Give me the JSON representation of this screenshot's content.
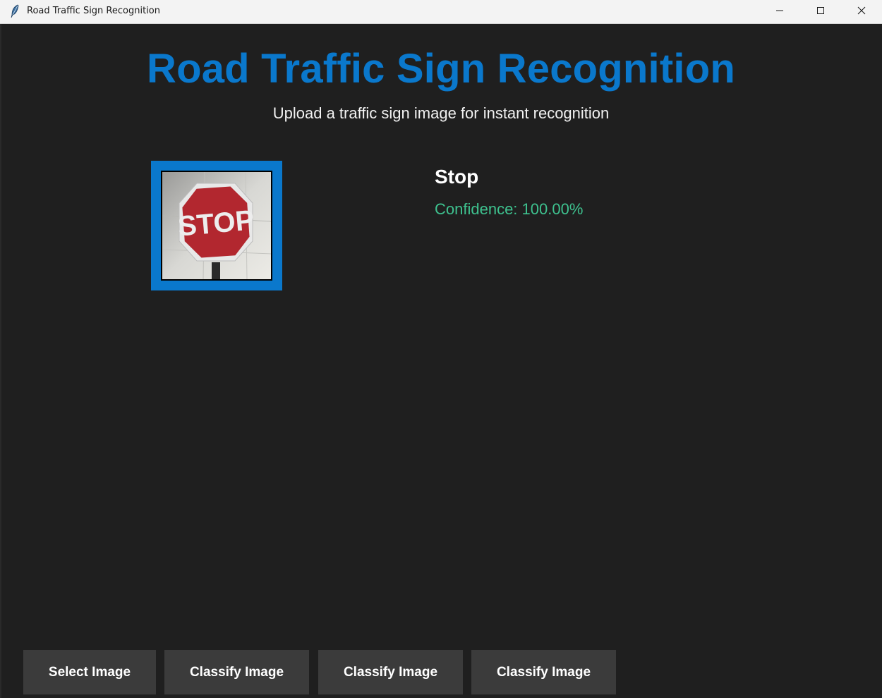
{
  "window": {
    "title": "Road Traffic Sign Recognition",
    "icon": "feather-icon",
    "controls": [
      "minimize-icon",
      "maximize-icon",
      "close-icon"
    ]
  },
  "header": {
    "title": "Road Traffic Sign Recognition",
    "subtitle": "Upload a traffic sign image for instant recognition"
  },
  "preview": {
    "sign_text": "STOP"
  },
  "result": {
    "label": "Stop",
    "confidence": "Confidence: 100.00%"
  },
  "buttons": {
    "select": "Select Image",
    "classify_1": "Classify Image",
    "classify_2": "Classify Image",
    "classify_3": "Classify Image"
  },
  "colors": {
    "accent": "#0a78cc",
    "background": "#1f1f1f",
    "confidence": "#3ec28f",
    "button": "#3b3b3b"
  }
}
